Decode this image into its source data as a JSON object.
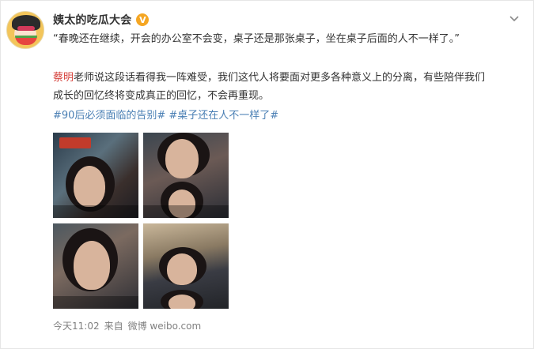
{
  "post": {
    "author": "姨太的吃瓜大会",
    "verified_badge": "V",
    "quote_line": "“春晚还在继续，开会的办公室不会变，桌子还是那张桌子，坐在桌子后面的人不一样了。”",
    "mention": "蔡明",
    "body_line_1_rest": "老师说这段话看得我一阵难受，我们这代人将要面对更多各种意义上的分离，有些陪伴我们",
    "body_line_2": "成长的回忆终将变成真正的回忆，不会再重现。",
    "hashtags": [
      "#90后必须面临的告别#",
      "#桌子还在人不一样了#"
    ],
    "time": "今天11:02",
    "source_prefix": "来自",
    "source_name": "微博 weibo.com"
  },
  "colors": {
    "mention": "#d6443e",
    "hashtag": "#4a7fb4",
    "meta": "#808080",
    "verified": "#f5a623"
  },
  "icons": {
    "menu": "chevron-down-icon",
    "verified": "verified-badge-icon"
  }
}
